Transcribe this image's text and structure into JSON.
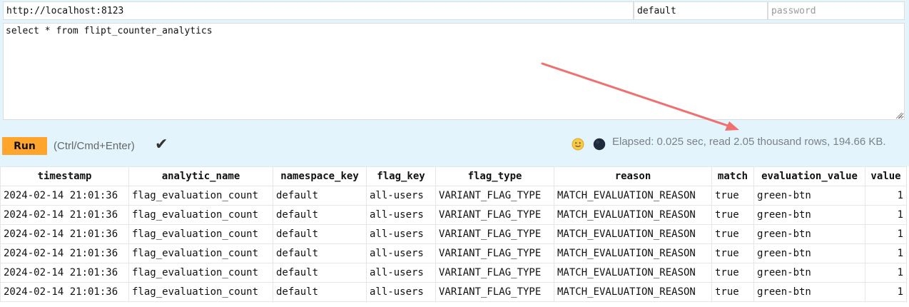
{
  "connection": {
    "url": "http://localhost:8123",
    "user": "default",
    "password_placeholder": "password"
  },
  "query": "select * from flipt_counter_analytics",
  "toolbar": {
    "run_label": "Run",
    "shortcut_hint": "(Ctrl/Cmd+Enter)",
    "status_icon": "✔",
    "elapsed_text": "Elapsed: 0.025 sec, read 2.05 thousand rows, 194.66 KB.",
    "smiley_icon": "smiley-face-icon",
    "theme_icon": "moon-theme-toggle-icon"
  },
  "colors": {
    "run_button": "#ffa52b",
    "top_panel_bg": "#e4f4fc",
    "annotation_arrow": "#f07070"
  },
  "results": {
    "columns": [
      "timestamp",
      "analytic_name",
      "namespace_key",
      "flag_key",
      "flag_type",
      "reason",
      "match",
      "evaluation_value",
      "value"
    ],
    "rows": [
      [
        "2024-02-14 21:01:36",
        "flag_evaluation_count",
        "default",
        "all-users",
        "VARIANT_FLAG_TYPE",
        "MATCH_EVALUATION_REASON",
        "true",
        "green-btn",
        "1"
      ],
      [
        "2024-02-14 21:01:36",
        "flag_evaluation_count",
        "default",
        "all-users",
        "VARIANT_FLAG_TYPE",
        "MATCH_EVALUATION_REASON",
        "true",
        "green-btn",
        "1"
      ],
      [
        "2024-02-14 21:01:36",
        "flag_evaluation_count",
        "default",
        "all-users",
        "VARIANT_FLAG_TYPE",
        "MATCH_EVALUATION_REASON",
        "true",
        "green-btn",
        "1"
      ],
      [
        "2024-02-14 21:01:36",
        "flag_evaluation_count",
        "default",
        "all-users",
        "VARIANT_FLAG_TYPE",
        "MATCH_EVALUATION_REASON",
        "true",
        "green-btn",
        "1"
      ],
      [
        "2024-02-14 21:01:36",
        "flag_evaluation_count",
        "default",
        "all-users",
        "VARIANT_FLAG_TYPE",
        "MATCH_EVALUATION_REASON",
        "true",
        "green-btn",
        "1"
      ],
      [
        "2024-02-14 21:01:36",
        "flag_evaluation_count",
        "default",
        "all-users",
        "VARIANT_FLAG_TYPE",
        "MATCH_EVALUATION_REASON",
        "true",
        "green-btn",
        "1"
      ]
    ]
  }
}
